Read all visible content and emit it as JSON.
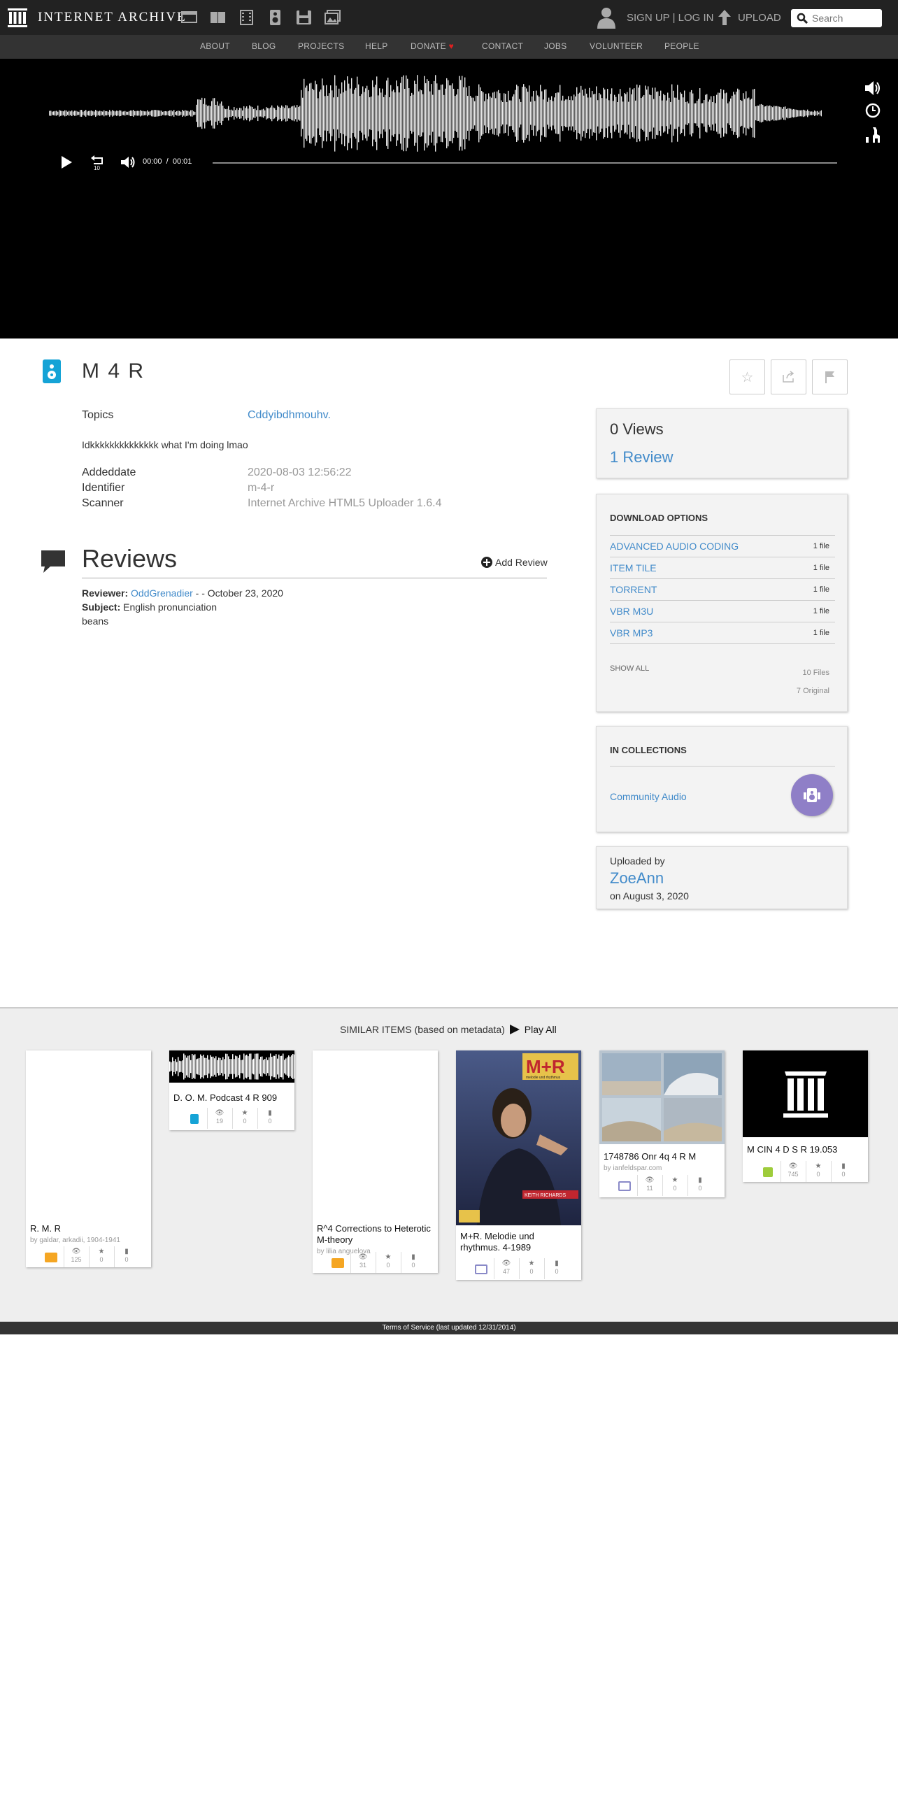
{
  "header": {
    "brand": "INTERNET ARCHIVE",
    "media_icons": [
      "web-icon",
      "texts-icon",
      "video-icon",
      "audio-icon",
      "software-icon",
      "images-icon"
    ],
    "auth": "SIGN UP | LOG IN",
    "upload": "UPLOAD",
    "search_placeholder": "Search"
  },
  "subnav": [
    "ABOUT",
    "BLOG",
    "PROJECTS",
    "HELP",
    "DONATE",
    "CONTACT",
    "JOBS",
    "VOLUNTEER",
    "PEOPLE"
  ],
  "player": {
    "current_time": "00:00",
    "separator": "/",
    "duration": "00:01"
  },
  "item": {
    "title": "M 4 R",
    "topics_label": "Topics",
    "topics_value": "Cddyibdhmouhv.",
    "description": "Idkkkkkkkkkkkkkk what I'm doing lmao",
    "meta": [
      {
        "label": "Addeddate",
        "value": "2020-08-03 12:56:22"
      },
      {
        "label": "Identifier",
        "value": "m-4-r"
      },
      {
        "label": "Scanner",
        "value": "Internet Archive HTML5 Uploader 1.6.4"
      }
    ]
  },
  "reviews": {
    "title": "Reviews",
    "add_review": "Add Review",
    "reviewer_label": "Reviewer:",
    "reviewer": "OddGrenadier",
    "date": "- - October 23, 2020",
    "subject_label": "Subject:",
    "subject": "English pronunciation",
    "body": "beans"
  },
  "stats_panel": {
    "views": "0 Views",
    "reviews": "1 Review"
  },
  "download": {
    "heading": "DOWNLOAD OPTIONS",
    "options": [
      {
        "name": "ADVANCED AUDIO CODING",
        "count": "1 file"
      },
      {
        "name": "ITEM TILE",
        "count": "1 file"
      },
      {
        "name": "TORRENT",
        "count": "1 file"
      },
      {
        "name": "VBR M3U",
        "count": "1 file"
      },
      {
        "name": "VBR MP3",
        "count": "1 file"
      }
    ],
    "show_all": "SHOW ALL",
    "files": "10 Files",
    "original": "7 Original"
  },
  "collections": {
    "heading": "IN COLLECTIONS",
    "name": "Community Audio"
  },
  "uploader": {
    "label": "Uploaded by",
    "name": "ZoeAnn",
    "date": "on August 3, 2020"
  },
  "similar": {
    "heading": "SIMILAR ITEMS (based on metadata)",
    "play_all": "Play All",
    "cards": [
      {
        "title": "R. M. R",
        "by": "by galdar, arkadii, 1904-1941",
        "type": "texts",
        "views": "125",
        "favs": "0",
        "reviews": "0"
      },
      {
        "title": "D. O. M. Podcast 4 R 909",
        "by": "",
        "type": "audio",
        "views": "19",
        "favs": "0",
        "reviews": "0"
      },
      {
        "title": "R^4 Corrections to Heterotic M-theory",
        "by": "by lilia anguelova",
        "type": "texts",
        "views": "31",
        "favs": "0",
        "reviews": "0"
      },
      {
        "title": "M+R. Melodie und rhythmus. 4-1989",
        "by": "",
        "type": "image",
        "views": "47",
        "favs": "0",
        "reviews": "0"
      },
      {
        "title": "1748786 Onr 4q 4 R M",
        "by": "by ianfeldspar.com",
        "type": "image",
        "views": "11",
        "favs": "0",
        "reviews": "0"
      },
      {
        "title": "M CIN 4 D S R 19.053",
        "by": "",
        "type": "software",
        "views": "745",
        "favs": "0",
        "reviews": "0"
      }
    ],
    "magazine_title": "M+R",
    "magazine_sub": "melodie und rhythmus",
    "magazine_banner": "KEITH RICHARDS"
  },
  "footer": "Terms of Service (last updated 12/31/2014)",
  "colors": {
    "link": "#428bca",
    "audio": "#15a3d6",
    "texts": "#f5a623",
    "software": "#9ecc3b",
    "image": "#8a8ac8",
    "collection": "#8f7fc7"
  }
}
